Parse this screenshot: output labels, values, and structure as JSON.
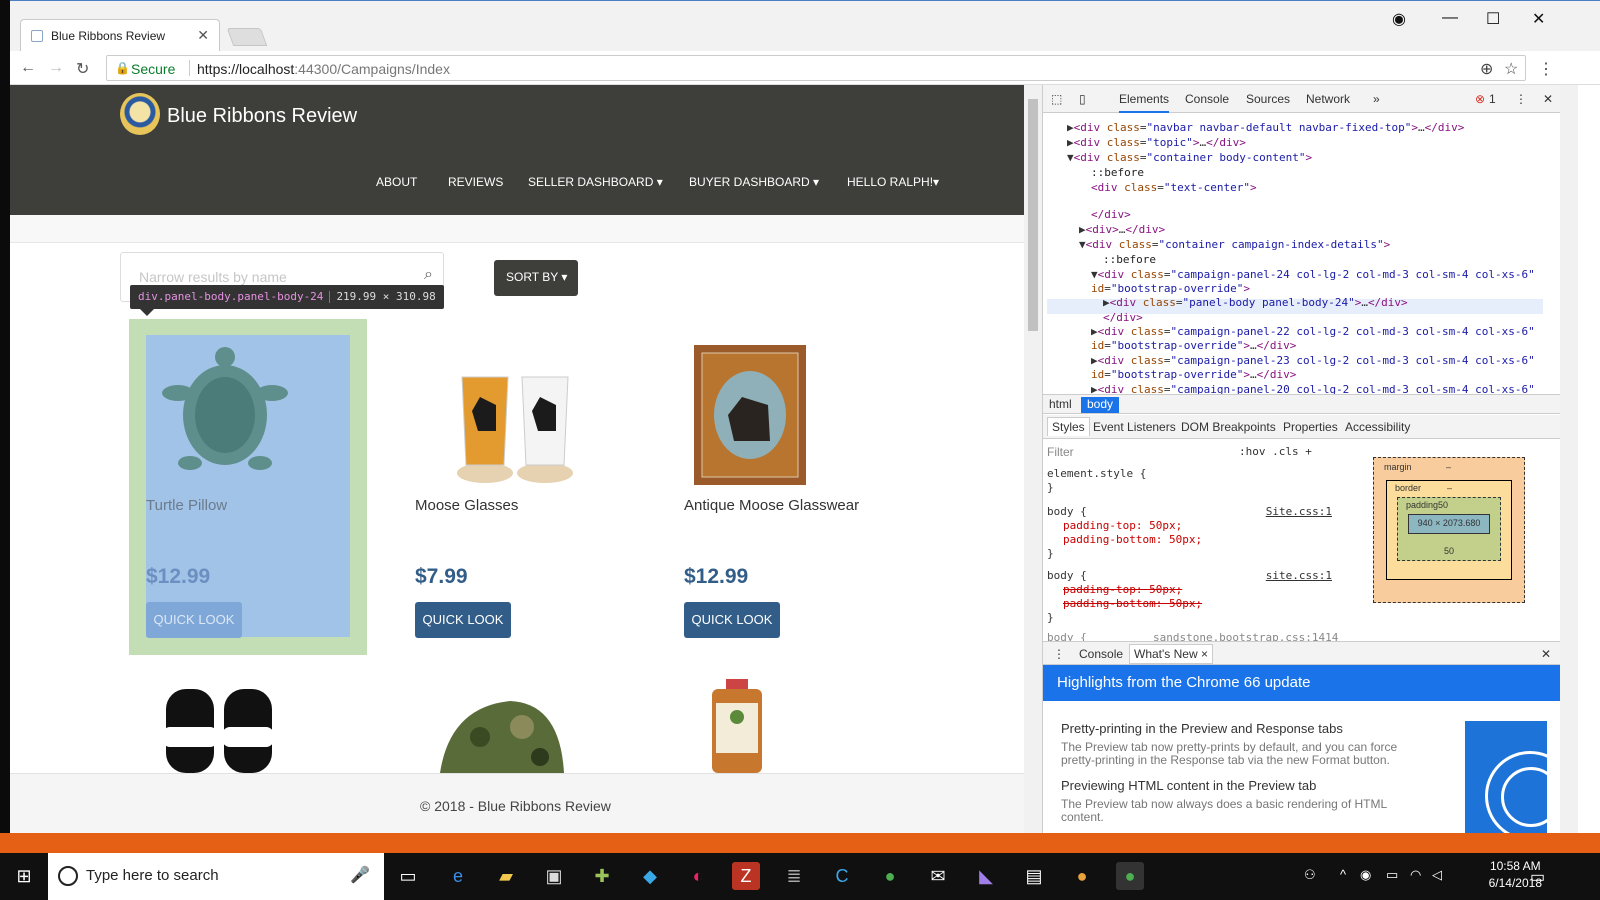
{
  "browser": {
    "tab_title": "Blue Ribbons Review",
    "secure_label": "Secure",
    "url_scheme_host": "https://localhost",
    "url_rest": ":44300/Campaigns/Index"
  },
  "site": {
    "brand": "Blue Ribbons Review",
    "nav": [
      "ABOUT",
      "REVIEWS",
      "SELLER DASHBOARD ▾",
      "BUYER DASHBOARD ▾",
      "HELLO RALPH!▾"
    ],
    "search_placeholder": "Narrow results by name",
    "sort_label": "SORT BY ▾",
    "footer": "© 2018 - Blue Ribbons Review"
  },
  "inspect_tooltip": {
    "selector": "div.panel-body.panel-body-24",
    "size": "219.99 × 310.98"
  },
  "products": [
    {
      "name": "Turtle Pillow",
      "price": "$12.99",
      "button": "QUICK LOOK",
      "icon": "turtle-image"
    },
    {
      "name": "Moose Glasses",
      "price": "$7.99",
      "button": "QUICK LOOK",
      "icon": "moose-glasses-image"
    },
    {
      "name": "Antique Moose Glasswear",
      "price": "$12.99",
      "button": "QUICK LOOK",
      "icon": "moose-glass-image"
    }
  ],
  "devtools": {
    "tabs": [
      "Elements",
      "Console",
      "Sources",
      "Network",
      "»"
    ],
    "error_count": "1",
    "breadcrumbs": [
      "html",
      "body"
    ],
    "style_tabs": [
      "Styles",
      "Event Listeners",
      "DOM Breakpoints",
      "Properties",
      "Accessibility"
    ],
    "filter_placeholder": "Filter",
    "filter_tools": ":hov  .cls  +",
    "rules": {
      "element_style": "element.style {",
      "body1_selector": "body {",
      "body1_link": "Site.css:1",
      "body1_p1": "padding-top: 50px;",
      "body1_p2": "padding-bottom: 50px;",
      "body2_selector": "body {",
      "body2_link": "site.css:1",
      "body2_p1": "padding-top: 50px;",
      "body2_p2": "padding-bottom: 50px;",
      "body3": "body {          sandstone.bootstrap.css:1414"
    },
    "box_model": {
      "margin": "margin",
      "margin_val": "–",
      "border": "border",
      "border_val": "–",
      "padding": "padding50",
      "content": "940 × 2073.680",
      "padding_bottom": "50"
    },
    "drawer_tabs": [
      "Console",
      "What's New ×"
    ],
    "whats_new_title": "Highlights from the Chrome 66 update",
    "news": [
      {
        "title": "Pretty-printing in the Preview and Response tabs",
        "body1": "The Preview tab now pretty-prints by default, and you can force",
        "body2": "pretty-printing in the Response tab via the new Format button."
      },
      {
        "title": "Previewing HTML content in the Preview tab",
        "body1": "The Preview tab now always does a basic rendering of HTML",
        "body2": "content."
      }
    ]
  },
  "taskbar": {
    "search_placeholder": "Type here to search",
    "time": "10:58 AM",
    "date": "6/14/2018"
  },
  "colors": {
    "navbar": "#3e3f3a",
    "primary": "#325d88",
    "devtools_accent": "#1a73e8"
  }
}
